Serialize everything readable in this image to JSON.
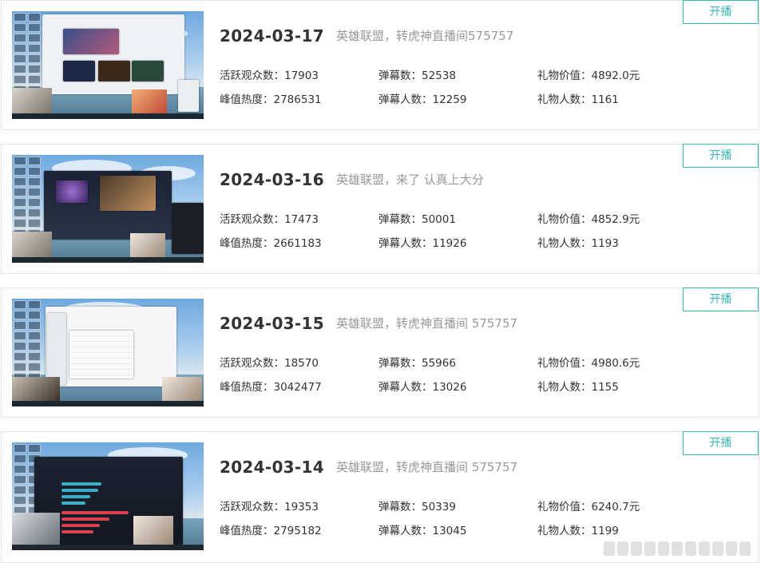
{
  "items": [
    {
      "date": "2024-03-17",
      "title": "英雄联盟，转虎神直播间575757",
      "button": "开播",
      "active_viewers": "活跃观众数：17903",
      "peak_heat": "峰值热度：2786531",
      "danmaku_count": "弹幕数：52538",
      "danmaku_users": "弹幕人数：12259",
      "gift_value": "礼物价值：4892.0元",
      "gift_users": "礼物人数：1161"
    },
    {
      "date": "2024-03-16",
      "title": "英雄联盟，来了 认真上大分",
      "button": "开播",
      "active_viewers": "活跃观众数：17473",
      "peak_heat": "峰值热度：2661183",
      "danmaku_count": "弹幕数：50001",
      "danmaku_users": "弹幕人数：11926",
      "gift_value": "礼物价值：4852.9元",
      "gift_users": "礼物人数：1193"
    },
    {
      "date": "2024-03-15",
      "title": "英雄联盟，转虎神直播间 575757",
      "button": "开播",
      "active_viewers": "活跃观众数：18570",
      "peak_heat": "峰值热度：3042477",
      "danmaku_count": "弹幕数：55966",
      "danmaku_users": "弹幕人数：13026",
      "gift_value": "礼物价值：4980.6元",
      "gift_users": "礼物人数：1155"
    },
    {
      "date": "2024-03-14",
      "title": "英雄联盟，转虎神直播间 575757",
      "button": "开播",
      "active_viewers": "活跃观众数：19353",
      "peak_heat": "峰值热度：2795182",
      "danmaku_count": "弹幕数：50339",
      "danmaku_users": "弹幕人数：13045",
      "gift_value": "礼物价值：6240.7元",
      "gift_users": "礼物人数：1199"
    }
  ],
  "colors": {
    "accent": "#3bb8b3",
    "date_text": "#333333",
    "title_text": "#999999",
    "border": "#e3e3e3"
  }
}
